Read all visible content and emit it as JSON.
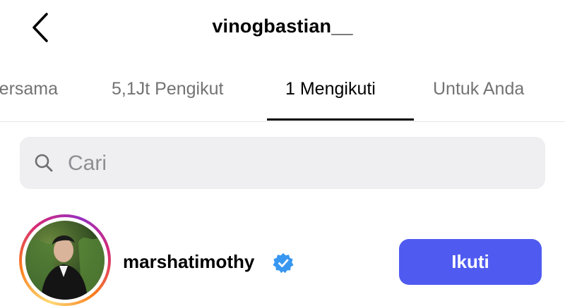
{
  "header": {
    "title": "vinogbastian__",
    "back_icon": "chevron-left-icon"
  },
  "tabs": [
    {
      "label": "Bersama",
      "active": false
    },
    {
      "label": "5,1Jt Pengikut",
      "active": false
    },
    {
      "label": "1 Mengikuti",
      "active": true
    },
    {
      "label": "Untuk Anda",
      "active": false
    }
  ],
  "search": {
    "placeholder": "Cari",
    "value": "",
    "icon": "search-icon"
  },
  "following": [
    {
      "username": "marshatimothy",
      "verified": true,
      "button_label": "Ikuti"
    }
  ],
  "colors": {
    "accent": "#4f5bf0",
    "verified": "#3897f0",
    "muted_text": "#737373",
    "search_bg": "#efeff1"
  }
}
